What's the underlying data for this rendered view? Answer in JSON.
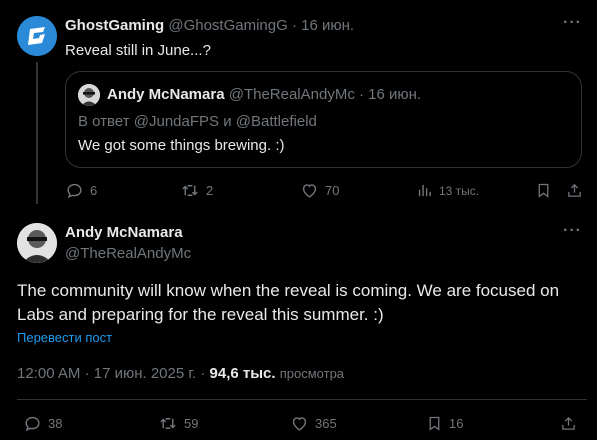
{
  "parent_tweet": {
    "name": "GhostGaming",
    "handle": "@GhostGamingG",
    "separator": "·",
    "date": "16 июн.",
    "text": "Reveal still in June...?",
    "more": "···",
    "quote": {
      "name": "Andy McNamara",
      "handle": "@TheRealAndyMc",
      "separator": "·",
      "date": "16 июн.",
      "reply_prefix": "В ответ",
      "reply_user1": "@JundaFPS",
      "reply_and": "и",
      "reply_user2": "@Battlefield",
      "text": "We got some things brewing. :)"
    },
    "stats": {
      "replies": "6",
      "retweets": "2",
      "likes": "70",
      "views": "13 тыс."
    }
  },
  "main_tweet": {
    "name": "Andy McNamara",
    "handle": "@TheRealAndyMc",
    "more": "···",
    "text": "The community will know when the reveal is coming. We are focused on Labs and preparing for the reveal this summer. :)",
    "translate": "Перевести пост",
    "time": "12:00 AM",
    "date": "17 июн. 2025 г.",
    "separator": "·",
    "views_count": "94,6 тыс.",
    "views_label": "просмотра",
    "stats": {
      "replies": "38",
      "retweets": "59",
      "likes": "365",
      "bookmarks": "16"
    }
  },
  "colors": {
    "background": "#000000",
    "text": "#e7e9ea",
    "muted": "#71767b",
    "accent": "#1d9bf0",
    "border": "#2f3336"
  }
}
